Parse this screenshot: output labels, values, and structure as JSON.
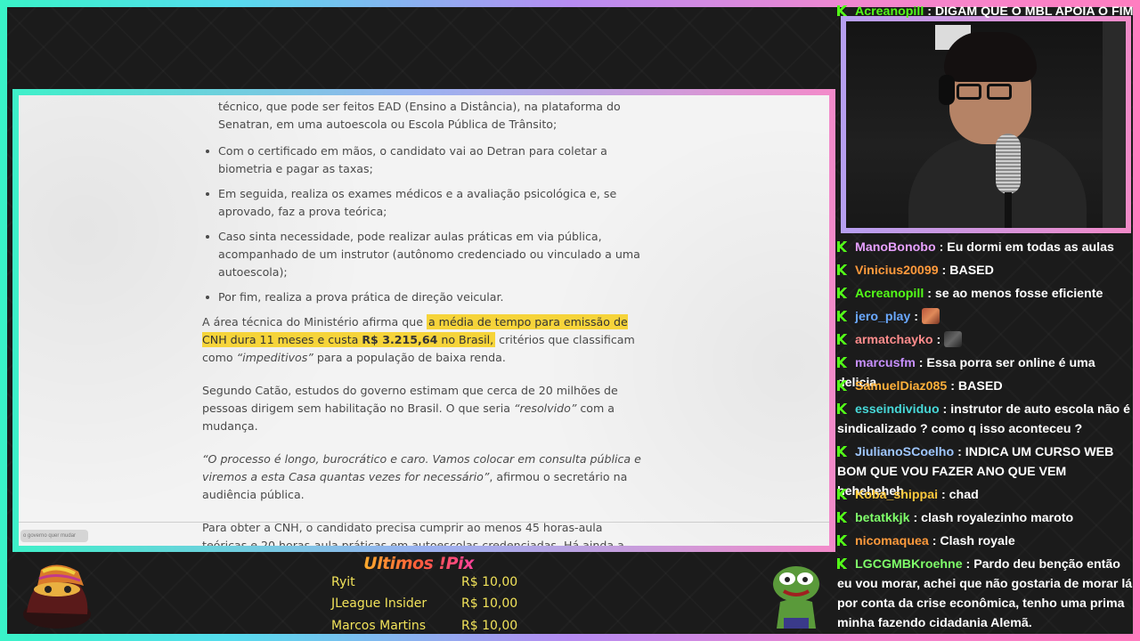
{
  "article": {
    "cont_line": "técnico, que pode ser feitos EAD (Ensino a Distância), na plataforma do Senatran, em uma autoescola ou Escola Pública de Trânsito;",
    "bullets": [
      "Com o certificado em mãos, o candidato vai ao Detran para coletar a biometria e pagar as taxas;",
      "Em seguida, realiza os exames médicos e a avaliação psicológica e, se aprovado, faz a prova teórica;",
      "Caso sinta necessidade, pode realizar aulas práticas em via pública, acompanhado de um instrutor (autônomo credenciado ou vinculado a uma autoescola);",
      "Por fim, realiza a prova prática de direção veicular."
    ],
    "p1_start": "A área técnica do Ministério afirma que ",
    "p1_hl_a": "a média de tempo para emissão de CNH dura 11 meses e custa ",
    "p1_hl_bold": "R$ 3.215,64",
    "p1_hl_b": " no Brasil,",
    "p1_mid": " critérios que classificam como ",
    "p1_italic": "“impeditivos”",
    "p1_end": " para a população de baixa renda.",
    "p2_start": "Segundo Catão, estudos do governo estimam que cerca de 20 milhões de pessoas dirigem sem habilitação no Brasil. O que seria ",
    "p2_italic": "“resolvido”",
    "p2_end": " com a mudança.",
    "p3_italic": "“O processo é longo, burocrático e caro. Vamos colocar em consulta pública e viremos a esta Casa quantas vezes for necessário”",
    "p3_end": ", afirmou o secretário na audiência pública.",
    "p4": "Para obter a CNH, o candidato precisa cumprir ao menos 45 horas-aula teóricas e 20 horas-aula práticas em autoescolas credenciadas. Há ainda a exigência de aulas noturnas e em simulador de direção, em alguns Estados. O governo argumenta que essas obrigações elevam o custo do processo sem garantir, necessariamente, melhor qualidade no",
    "scroll_tag": "o governo quer mudar"
  },
  "chat": {
    "top": {
      "user": "Acreanopill",
      "text": " : DIGAM QUE O MBL APOIA O FIM",
      "color": "#53fc18"
    },
    "messages": [
      {
        "user": "ManoBonobo",
        "text": " : Eu dormi em todas as aulas",
        "color": "#e7a0ff"
      },
      {
        "user": "Vinicius20099",
        "text": " : BASED",
        "color": "#ff9a3c"
      },
      {
        "user": "Acreanopill",
        "text": " : se ao menos fosse eficiente",
        "color": "#53fc18"
      },
      {
        "user": "jero_play",
        "text": " : ",
        "color": "#6aa8ff",
        "emote": "brick"
      },
      {
        "user": "armatchayko",
        "text": " : ",
        "color": "#ff8c8c",
        "emote": "dark"
      },
      {
        "user": "marcusfm",
        "text": " : Essa porra ser online é uma delicia",
        "color": "#c890ff"
      },
      {
        "user": "SamuelDiaz085",
        "text": " : BASED",
        "color": "#ffb03a"
      },
      {
        "user": "esseindividuo",
        "text": " : instrutor de auto escola não é sindicalizado ? como q isso aconteceu ?",
        "color": "#47d8d8"
      },
      {
        "user": "JiulianoSCoelho",
        "text": " : INDICA UM CURSO WEB BOM QUE VOU FAZER ANO QUE VEM heheheheh",
        "color": "#9fc7ff"
      },
      {
        "user": "Koba_shippai",
        "text": " : chad",
        "color": "#ffc93c"
      },
      {
        "user": "betatkkjk",
        "text": " : clash royalezinho maroto",
        "color": "#7fff6a"
      },
      {
        "user": "nicomaquea",
        "text": " : Clash royale",
        "color": "#ff9a3c"
      },
      {
        "user": "LGCGMBKroehne",
        "text": " : Pardo deu benção então eu vou morar, achei que não gostaria de morar lá por conta da crise econômica, tenho uma prima minha fazendo cidadania Alemã.",
        "color": "#7fff6a"
      }
    ]
  },
  "pix": {
    "title": "Ultimos !Pix",
    "rows": [
      {
        "name": "Ryit",
        "value": "R$ 10,00"
      },
      {
        "name": "JLeague Insider",
        "value": "R$ 10,00"
      },
      {
        "name": "Marcos Martins",
        "value": "R$ 10,00"
      }
    ]
  }
}
